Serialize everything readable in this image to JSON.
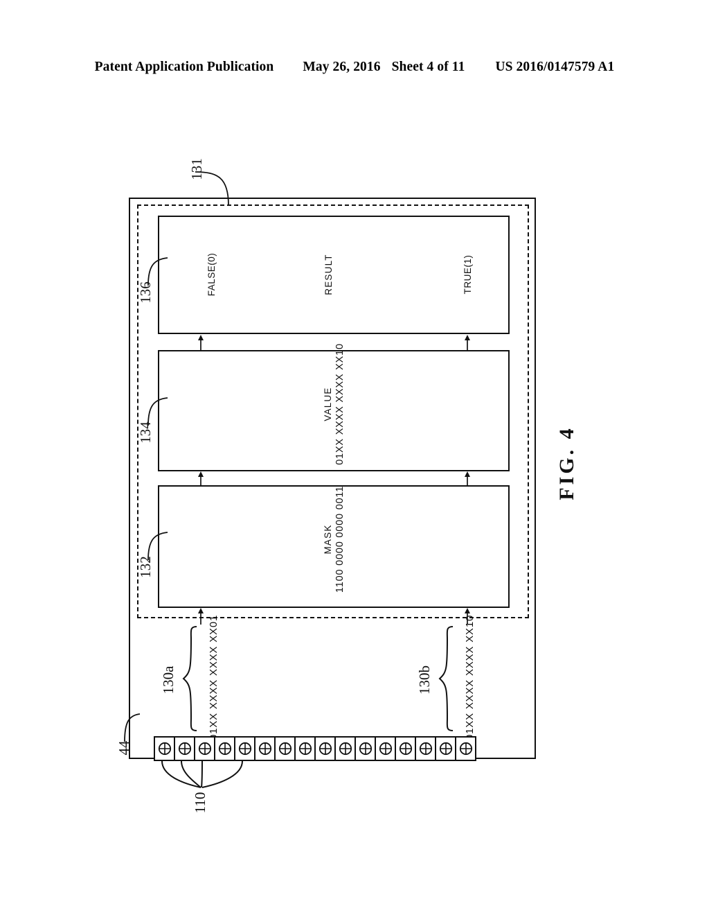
{
  "header": {
    "publication": "Patent Application Publication",
    "date": "May 26, 2016",
    "sheet": "Sheet 4 of 11",
    "patent_number": "US 2016/0147579 A1"
  },
  "figure": {
    "caption": "FIG. 4",
    "device_ref": "44",
    "logic_region_ref": "131",
    "blocks": [
      {
        "ref": "136",
        "name": "result-block",
        "labels": {
          "left": "FALSE(0)",
          "center": "RESULT",
          "right": "TRUE(1)"
        }
      },
      {
        "ref": "134",
        "name": "value-block",
        "title": "VALUE",
        "bits": "01XX XXXX XXXX XX10"
      },
      {
        "ref": "132",
        "name": "mask-block",
        "title": "MASK",
        "bits": "1100 0000 0000 0011"
      }
    ],
    "bit_groups": [
      {
        "ref": "130a",
        "bits": "01XX XXXX XXXX XX01"
      },
      {
        "ref": "130b",
        "bits": "01XX XXXX XXXX XX10"
      }
    ],
    "connector": {
      "ref": "110",
      "pin_count": 16,
      "pin_icon": "circled-plus-icon"
    }
  }
}
